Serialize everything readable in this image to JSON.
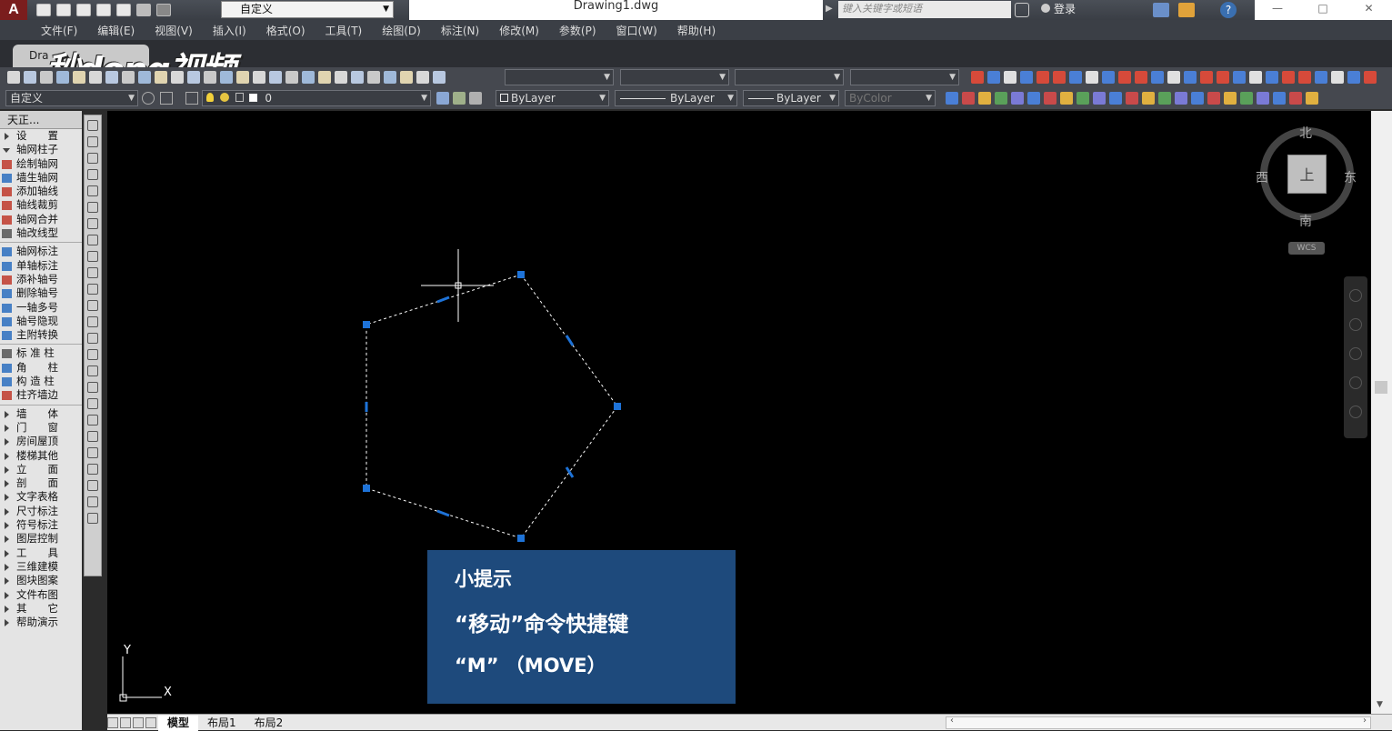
{
  "titlebar": {
    "app_logo": "A",
    "workspace": "自定义",
    "document_title": "Drawing1.dwg",
    "search_placeholder": "键入关键字或短语",
    "login_label": "登录",
    "help_symbol": "?"
  },
  "menubar": {
    "items": [
      "文件(F)",
      "编辑(E)",
      "视图(V)",
      "插入(I)",
      "格式(O)",
      "工具(T)",
      "绘图(D)",
      "标注(N)",
      "修改(M)",
      "参数(P)",
      "窗口(W)",
      "帮助(H)"
    ]
  },
  "doc_tab": {
    "label": "Dra"
  },
  "watermark": "秒dong视频",
  "toolbar2": {
    "workspace_combo": "自定义",
    "layer_combo": "0",
    "color_combo": "ByLayer",
    "linetype_combo": "ByLayer",
    "lineweight_combo": "ByLayer",
    "plotstyle_combo": "ByColor"
  },
  "left_panel": {
    "header": "天正...",
    "items": [
      {
        "label": "设　　置",
        "kind": "group"
      },
      {
        "label": "轴网柱子",
        "kind": "open"
      },
      {
        "label": "绘制轴网",
        "kind": "cmd",
        "color": "#c0392b"
      },
      {
        "label": "墙生轴网",
        "kind": "cmd",
        "color": "#2c6ebf"
      },
      {
        "label": "添加轴线",
        "kind": "cmd",
        "color": "#c0392b"
      },
      {
        "label": "轴线裁剪",
        "kind": "cmd",
        "color": "#c0392b"
      },
      {
        "label": "轴网合并",
        "kind": "cmd",
        "color": "#c0392b"
      },
      {
        "label": "轴改线型",
        "kind": "cmd",
        "color": "#555555"
      },
      {
        "label": "sep",
        "kind": "sep"
      },
      {
        "label": "轴网标注",
        "kind": "cmd",
        "color": "#2c6ebf"
      },
      {
        "label": "单轴标注",
        "kind": "cmd",
        "color": "#2c6ebf"
      },
      {
        "label": "添补轴号",
        "kind": "cmd",
        "color": "#c0392b"
      },
      {
        "label": "删除轴号",
        "kind": "cmd",
        "color": "#2c6ebf"
      },
      {
        "label": "一轴多号",
        "kind": "cmd",
        "color": "#2c6ebf"
      },
      {
        "label": "轴号隐现",
        "kind": "cmd",
        "color": "#2c6ebf"
      },
      {
        "label": "主附转换",
        "kind": "cmd",
        "color": "#2c6ebf"
      },
      {
        "label": "sep",
        "kind": "sep"
      },
      {
        "label": "标 准 柱",
        "kind": "cmd",
        "color": "#555555"
      },
      {
        "label": "角　　柱",
        "kind": "cmd",
        "color": "#2c6ebf"
      },
      {
        "label": "构 造 柱",
        "kind": "cmd",
        "color": "#2c6ebf"
      },
      {
        "label": "柱齐墙边",
        "kind": "cmd",
        "color": "#c0392b"
      },
      {
        "label": "sep",
        "kind": "sep"
      },
      {
        "label": "墙　　体",
        "kind": "group"
      },
      {
        "label": "门　　窗",
        "kind": "group"
      },
      {
        "label": "房间屋顶",
        "kind": "group"
      },
      {
        "label": "楼梯其他",
        "kind": "group"
      },
      {
        "label": "立　　面",
        "kind": "group"
      },
      {
        "label": "剖　　面",
        "kind": "group"
      },
      {
        "label": "文字表格",
        "kind": "group"
      },
      {
        "label": "尺寸标注",
        "kind": "group"
      },
      {
        "label": "符号标注",
        "kind": "group"
      },
      {
        "label": "图层控制",
        "kind": "group"
      },
      {
        "label": "工　　具",
        "kind": "group"
      },
      {
        "label": "三维建模",
        "kind": "group"
      },
      {
        "label": "图块图案",
        "kind": "group"
      },
      {
        "label": "文件布图",
        "kind": "group"
      },
      {
        "label": "其　　它",
        "kind": "group"
      },
      {
        "label": "帮助演示",
        "kind": "group"
      }
    ]
  },
  "viewcube": {
    "north": "北",
    "south": "南",
    "east": "东",
    "west": "西",
    "face": "上",
    "wcs": "WCS"
  },
  "ucs": {
    "y_label": "Y",
    "x_label": "X"
  },
  "tip": {
    "title": "小提示",
    "line1": "“移动”命令快捷键",
    "line2": "“M” （MOVE）"
  },
  "layout_tabs": [
    "模型",
    "布局1",
    "布局2"
  ],
  "active_layout": "模型",
  "colors": {
    "canvas": "#000000",
    "grip": "#1e73d8",
    "tip_bg": "#1e4a7c"
  }
}
